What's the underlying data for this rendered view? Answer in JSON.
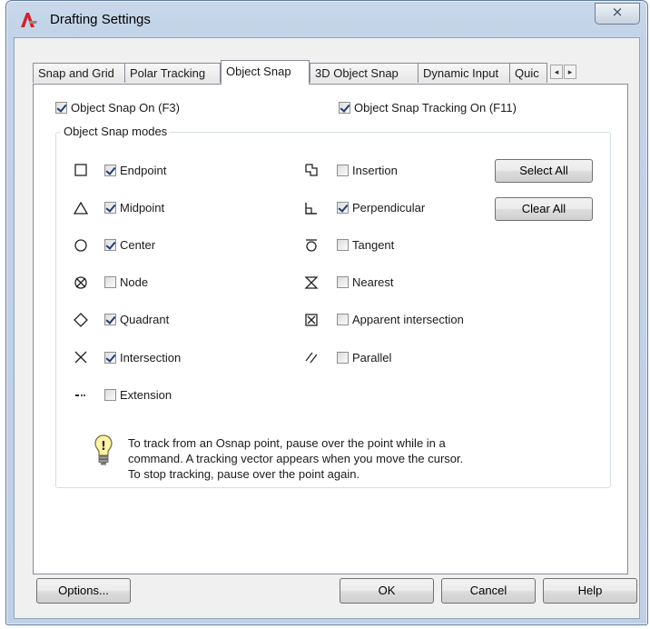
{
  "window": {
    "title": "Drafting Settings",
    "close_label": "⨯"
  },
  "tabs": [
    {
      "label": "Snap and Grid",
      "active": false
    },
    {
      "label": "Polar Tracking",
      "active": false
    },
    {
      "label": "Object Snap",
      "active": true
    },
    {
      "label": "3D Object Snap",
      "active": false
    },
    {
      "label": "Dynamic Input",
      "active": false
    },
    {
      "label": "Quic",
      "active": false
    }
  ],
  "tab_scroll": {
    "left": "◂",
    "right": "▸"
  },
  "object_snap_on": {
    "label": "Object Snap On (F3)",
    "checked": true
  },
  "object_snap_tracking_on": {
    "label": "Object Snap Tracking On (F11)",
    "checked": true
  },
  "modes_group_title": "Object Snap modes",
  "modes_left": [
    {
      "label": "Endpoint",
      "checked": true,
      "icon": "endpoint-square-icon"
    },
    {
      "label": "Midpoint",
      "checked": true,
      "icon": "midpoint-triangle-icon"
    },
    {
      "label": "Center",
      "checked": true,
      "icon": "center-circle-icon"
    },
    {
      "label": "Node",
      "checked": false,
      "icon": "node-icon"
    },
    {
      "label": "Quadrant",
      "checked": true,
      "icon": "quadrant-diamond-icon"
    },
    {
      "label": "Intersection",
      "checked": true,
      "icon": "intersection-x-icon"
    },
    {
      "label": "Extension",
      "checked": false,
      "icon": "extension-icon"
    }
  ],
  "modes_right": [
    {
      "label": "Insertion",
      "checked": false,
      "icon": "insertion-icon"
    },
    {
      "label": "Perpendicular",
      "checked": true,
      "icon": "perpendicular-icon"
    },
    {
      "label": "Tangent",
      "checked": false,
      "icon": "tangent-icon"
    },
    {
      "label": "Nearest",
      "checked": false,
      "icon": "nearest-hourglass-icon"
    },
    {
      "label": "Apparent intersection",
      "checked": false,
      "icon": "apparent-intersection-icon"
    },
    {
      "label": "Parallel",
      "checked": false,
      "icon": "parallel-icon"
    }
  ],
  "buttons": {
    "select_all": "Select All",
    "clear_all": "Clear All",
    "options": "Options...",
    "ok": "OK",
    "cancel": "Cancel",
    "help": "Help"
  },
  "hint": {
    "icon": "lightbulb-icon",
    "line1": "To track from an Osnap point, pause over the point while in a",
    "line2": "command.  A tracking vector appears when you move the cursor.",
    "line3": "To stop tracking, pause over the point again."
  }
}
